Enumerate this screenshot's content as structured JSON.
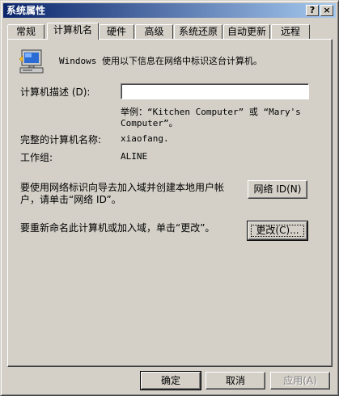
{
  "window": {
    "title": "系统属性",
    "help_button": "?",
    "close_button": "×"
  },
  "tabs": [
    {
      "label": "常规",
      "active": false
    },
    {
      "label": "计算机名",
      "active": true
    },
    {
      "label": "硬件",
      "active": false
    },
    {
      "label": "高级",
      "active": false
    },
    {
      "label": "系统还原",
      "active": false
    },
    {
      "label": "自动更新",
      "active": false
    },
    {
      "label": "远程",
      "active": false
    }
  ],
  "computer_name": {
    "intro": "Windows 使用以下信息在网络中标识这台计算机。",
    "description_label": "计算机描述 (D):",
    "description_value": "",
    "example_line1": "举例：“Kitchen Computer” 或 “Mary's",
    "example_line2": "Computer”。",
    "full_name_label": "完整的计算机名称:",
    "full_name_value": "xiaofang.",
    "workgroup_label": "工作组:",
    "workgroup_value": "ALINE",
    "network_id_text_line1": "要使用网络标识向导去加入域并创建本地用户帐",
    "network_id_text_line2": "户，请单击“网络 ID”。",
    "network_id_button": "网络 ID(N)",
    "rename_text": "要重新命名此计算机或加入域，单击“更改”。",
    "change_button": "更改(C)..."
  },
  "footer": {
    "ok_button": "确定",
    "cancel_button": "取消",
    "apply_button": "应用(A)"
  }
}
